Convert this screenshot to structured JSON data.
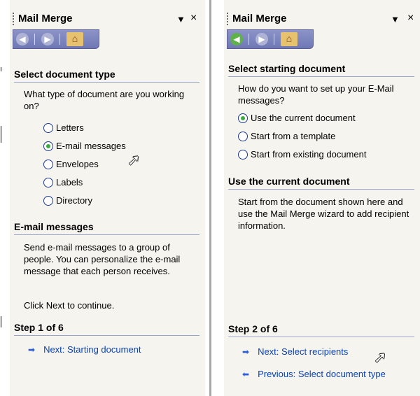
{
  "pane1": {
    "title": "Mail Merge",
    "section1": {
      "heading": "Select document type",
      "question": "What type of document are you working on?",
      "options": [
        {
          "label": "Letters",
          "checked": false
        },
        {
          "label": "E-mail messages",
          "checked": true
        },
        {
          "label": "Envelopes",
          "checked": false
        },
        {
          "label": "Labels",
          "checked": false
        },
        {
          "label": "Directory",
          "checked": false
        }
      ]
    },
    "section2": {
      "heading": "E-mail messages",
      "description": "Send e-mail messages to a group of people. You can personalize the e-mail message that each person receives.",
      "instruction": "Click Next to continue."
    },
    "step": {
      "label": "Step 1 of 6",
      "next_link": "Next: Starting document"
    }
  },
  "pane2": {
    "title": "Mail Merge",
    "section1": {
      "heading": "Select starting document",
      "question": "How do you want to set up your E-Mail messages?",
      "options": [
        {
          "label": "Use the current document",
          "checked": true
        },
        {
          "label": "Start from a template",
          "checked": false
        },
        {
          "label": "Start from existing document",
          "checked": false
        }
      ]
    },
    "section2": {
      "heading": "Use the current document",
      "description": "Start from the document shown here and use the Mail Merge wizard to add recipient information."
    },
    "step": {
      "label": "Step 2 of 6",
      "next_link": "Next: Select recipients",
      "previous_link": "Previous: Select document type"
    }
  },
  "icons": {
    "nav_back": "back-arrow-icon",
    "nav_forward": "forward-arrow-icon",
    "nav_home": "home-icon",
    "dropdown": "dropdown-arrow-icon",
    "close": "close-icon",
    "link_next": "right-arrow-icon",
    "link_prev": "left-arrow-icon"
  },
  "colors": {
    "pane_bg": "#f5f4ee",
    "navbar": "#7b82bd",
    "link": "#0a42b6",
    "radio_check": "#3faa3f"
  }
}
